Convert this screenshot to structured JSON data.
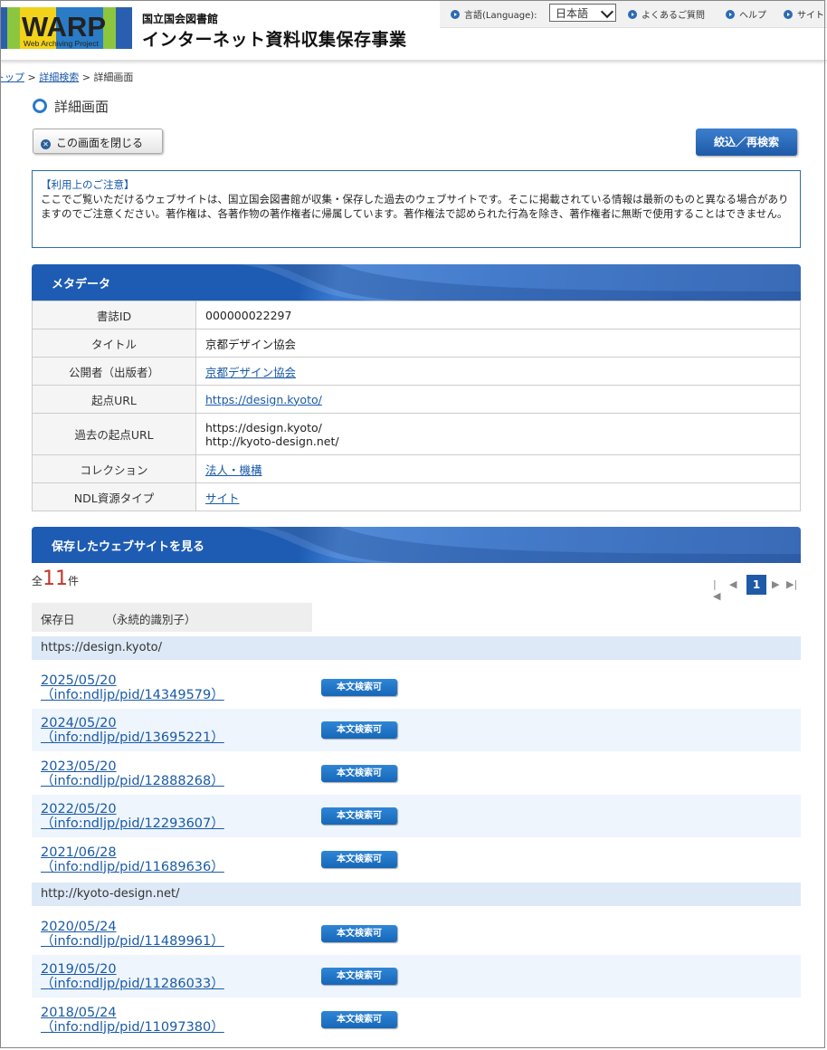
{
  "header": {
    "logo_main": "WARP",
    "logo_sub": "Web Archiving Project",
    "org": "国立国会図書館",
    "project": "インターネット資料収集保存事業",
    "lang_label": "言語(Language):",
    "lang_value": "日本語",
    "faq": "よくあるご質問",
    "help": "ヘルプ",
    "sitemap": "サイト"
  },
  "breadcrumb": {
    "top": "トップ",
    "search": "詳細検索",
    "current": "詳細画面",
    "sep": ">"
  },
  "page": {
    "title": "詳細画面",
    "close_label": "この画面を閉じる",
    "refine_label": "絞込／再検索"
  },
  "notice": {
    "title": "【利用上のご注意】",
    "body": "ここでご覧いただけるウェブサイトは、国立国会図書館が収集・保存した過去のウェブサイトです。そこに掲載されている情報は最新のものと異なる場合がありますのでご注意ください。著作権は、各著作物の著作権者に帰属しています。著作権法で認められた行為を除き、著作権者に無断で使用することはできません。"
  },
  "metadata": {
    "heading": "メタデータ",
    "rows": [
      {
        "key": "書誌ID",
        "value": "000000022297"
      },
      {
        "key": "タイトル",
        "value": "京都デザイン協会"
      },
      {
        "key": "公開者（出版者）",
        "value": "京都デザイン協会"
      },
      {
        "key": "起点URL",
        "value": "https://design.kyoto/"
      },
      {
        "key": "過去の起点URL",
        "value": "https://design.kyoto/",
        "value2": "http://kyoto-design.net/"
      },
      {
        "key": "コレクション",
        "value": "法人・機構"
      },
      {
        "key": "NDL資源タイプ",
        "value": "サイト"
      }
    ]
  },
  "archive": {
    "heading": "保存したウェブサイトを見る",
    "total_prefix": "全",
    "total": "11",
    "total_suffix": "件",
    "current_page": "1",
    "col_date": "保存日",
    "col_id": "（永続的識別子）",
    "badge": "本文検索可",
    "groups": [
      {
        "url": "https://design.kyoto/",
        "items": [
          {
            "date": "2025/05/20",
            "pid": "（info:ndljp/pid/14349579）"
          },
          {
            "date": "2024/05/20",
            "pid": "（info:ndljp/pid/13695221）"
          },
          {
            "date": "2023/05/20",
            "pid": "（info:ndljp/pid/12888268）"
          },
          {
            "date": "2022/05/20",
            "pid": "（info:ndljp/pid/12293607）"
          },
          {
            "date": "2021/06/28",
            "pid": "（info:ndljp/pid/11689636）"
          }
        ]
      },
      {
        "url": "http://kyoto-design.net/",
        "items": [
          {
            "date": "2020/05/24",
            "pid": "（info:ndljp/pid/11489961）"
          },
          {
            "date": "2019/05/20",
            "pid": "（info:ndljp/pid/11286033）"
          },
          {
            "date": "2018/05/24",
            "pid": "（info:ndljp/pid/11097380）"
          }
        ]
      }
    ]
  }
}
